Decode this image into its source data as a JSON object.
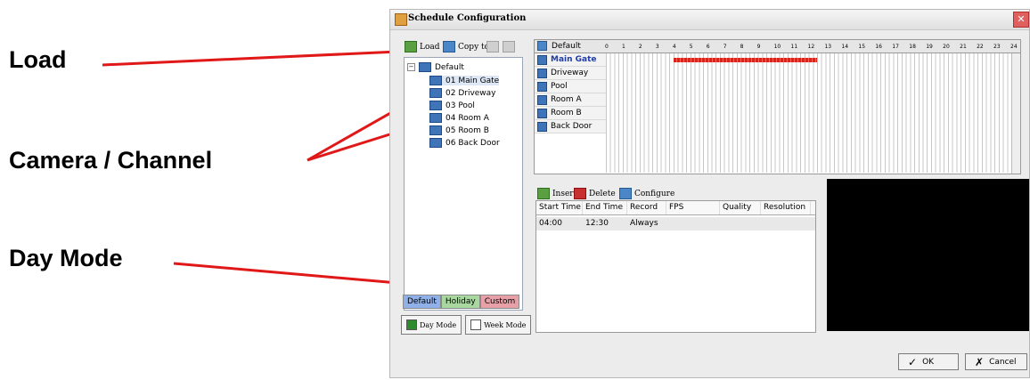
{
  "annotations": {
    "load": "Load",
    "camera_channel": "Camera / Channel",
    "day_mode": "Day Mode"
  },
  "window": {
    "title": "Schedule Configuration",
    "close_glyph": "✕"
  },
  "left_toolbar": {
    "load": "Load",
    "copy_to": "Copy to"
  },
  "tree": {
    "root": "Default",
    "items": [
      "01 Main Gate",
      "02 Driveway",
      "03 Pool",
      "04 Room A",
      "05 Room B",
      "06 Back Door"
    ]
  },
  "day_tabs": [
    "Default",
    "Holiday",
    "Custom"
  ],
  "mode_buttons": {
    "day": "Day Mode",
    "week": "Week Mode"
  },
  "schedule_grid": {
    "header": "Default",
    "hours": [
      "0",
      "1",
      "2",
      "3",
      "4",
      "5",
      "6",
      "7",
      "8",
      "9",
      "10",
      "11",
      "12",
      "13",
      "14",
      "15",
      "16",
      "17",
      "18",
      "19",
      "20",
      "21",
      "22",
      "23",
      "24"
    ],
    "channels": [
      "Main Gate",
      "Driveway",
      "Pool",
      "Room A",
      "Room B",
      "Back Door"
    ],
    "selected_channel": "Main Gate",
    "bar": {
      "start_hour": 4.0,
      "end_hour": 12.5
    }
  },
  "actions": {
    "insert": "Insert",
    "delete": "Delete",
    "configure": "Configure"
  },
  "record_table": {
    "columns": [
      "Start Time",
      "End Time",
      "Record",
      "FPS",
      "Quality",
      "Resolution"
    ],
    "rows": [
      [
        "04:00",
        "12:30",
        "Always",
        "",
        "",
        ""
      ]
    ]
  },
  "dialog_buttons": {
    "ok": "OK",
    "cancel": "Cancel",
    "ok_glyph": "✓",
    "cancel_glyph": "✗"
  },
  "colors": {
    "schedule_bar": "#d8251b",
    "annotation_line": "#e01818"
  }
}
